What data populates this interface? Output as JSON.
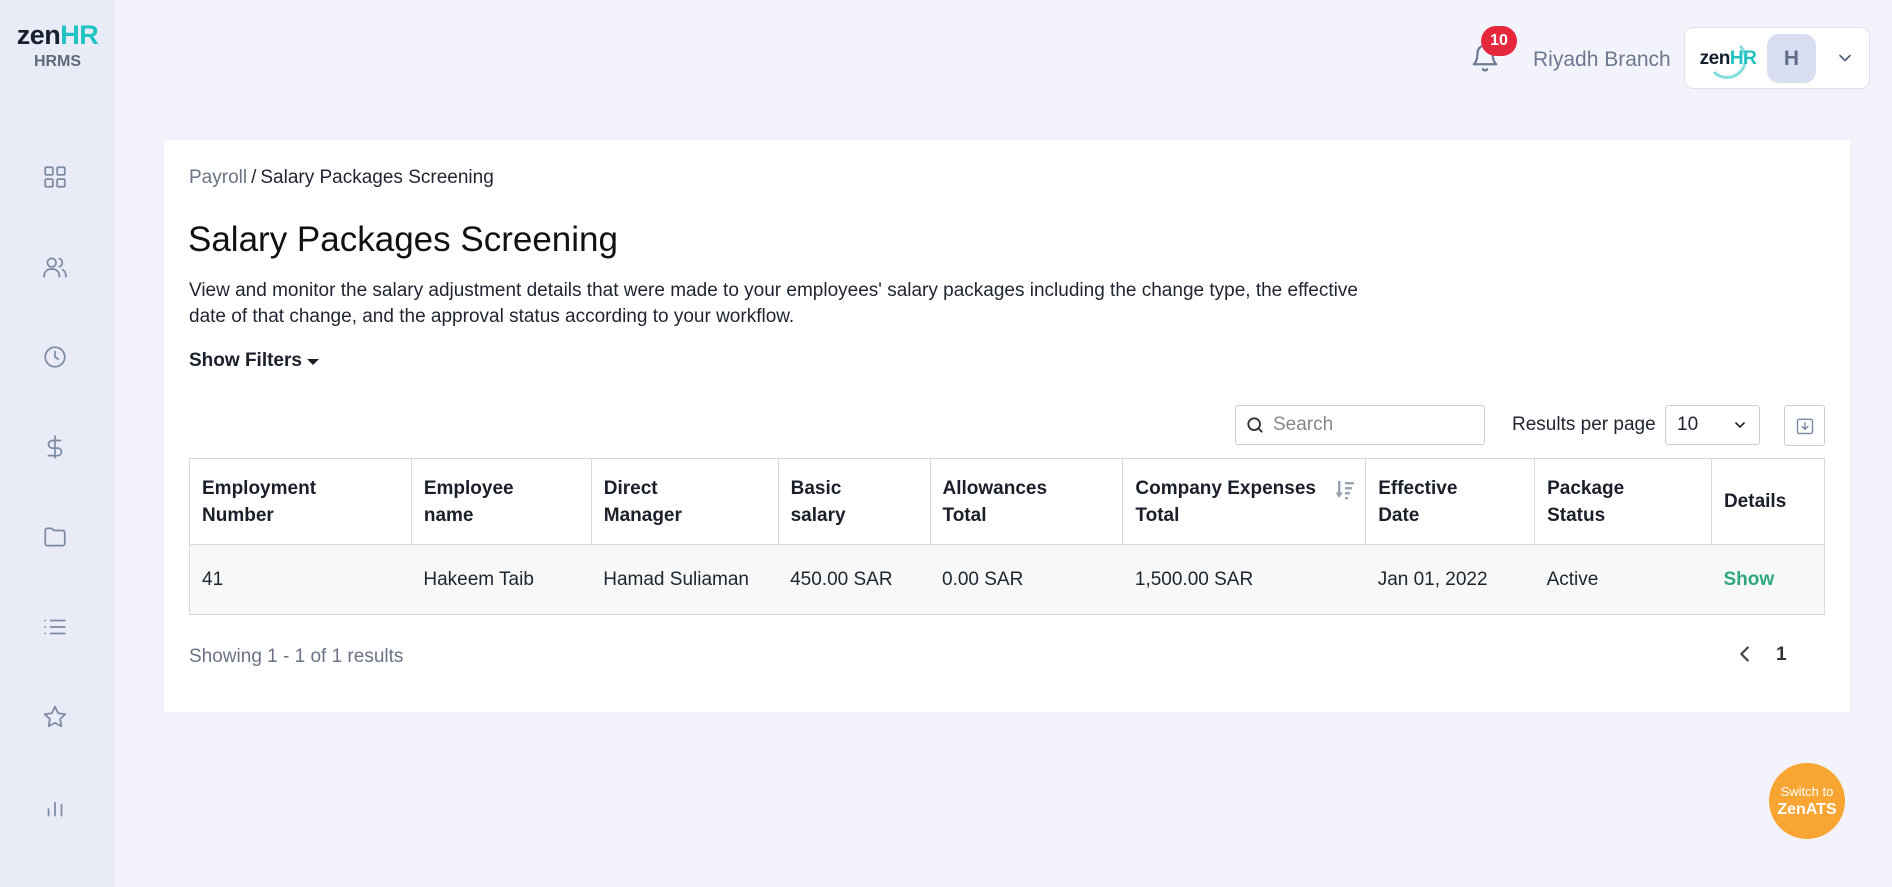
{
  "app": {
    "logo_zen": "zen",
    "logo_hr": "HR",
    "logo_sub": "HRMS"
  },
  "sidebar": {
    "items": [
      {
        "icon": "dashboard-grid-icon"
      },
      {
        "icon": "people-icon"
      },
      {
        "icon": "clock-icon"
      },
      {
        "icon": "dollar-icon"
      },
      {
        "icon": "folder-icon"
      },
      {
        "icon": "list-icon"
      },
      {
        "icon": "star-icon"
      },
      {
        "icon": "bar-chart-icon"
      }
    ]
  },
  "header": {
    "notification_count": "10",
    "branch": "Riyadh Branch",
    "account_logo_zen": "zen",
    "account_logo_hr": "HR",
    "avatar_initial": "H"
  },
  "page": {
    "breadcrumb_parent": "Payroll",
    "breadcrumb_separator": "/",
    "breadcrumb_current": "Salary Packages Screening",
    "title": "Salary Packages Screening",
    "description": "View and monitor the salary adjustment details that were made to your employees' salary packages including the change type, the effective date of that change, and the approval status according to your workflow.",
    "show_filters": "Show Filters"
  },
  "toolbar": {
    "search_placeholder": "Search",
    "results_per_page_label": "Results per page",
    "results_per_page_value": "10"
  },
  "table": {
    "headers": {
      "employment_number_1": "Employment",
      "employment_number_2": "Number",
      "employee_name_1": "Employee",
      "employee_name_2": "name",
      "direct_manager_1": "Direct",
      "direct_manager_2": "Manager",
      "basic_salary_1": "Basic",
      "basic_salary_2": "salary",
      "allowances_total_1": "Allowances",
      "allowances_total_2": "Total",
      "company_expenses_total_1": "Company Expenses",
      "company_expenses_total_2": "Total",
      "effective_date_1": "Effective",
      "effective_date_2": "Date",
      "package_status_1": "Package",
      "package_status_2": "Status",
      "details": "Details"
    },
    "rows": [
      {
        "employment_number": "41",
        "employee_name": "Hakeem Taib",
        "direct_manager": "Hamad Suliaman",
        "basic_salary": "450.00 SAR",
        "allowances_total": "0.00 SAR",
        "company_expenses_total": "1,500.00 SAR",
        "effective_date": "Jan 01, 2022",
        "package_status": "Active",
        "details_link": "Show"
      }
    ]
  },
  "pagination": {
    "summary": "Showing 1 - 1 of 1 results",
    "current_page": "1"
  },
  "switch_button": {
    "line1": "Switch to",
    "line2": "ZenATS"
  },
  "colors": {
    "accent_teal": "#21c2c2",
    "link_green": "#2fa77d",
    "badge_red": "#e5283c",
    "switch_orange": "#f9a533"
  }
}
